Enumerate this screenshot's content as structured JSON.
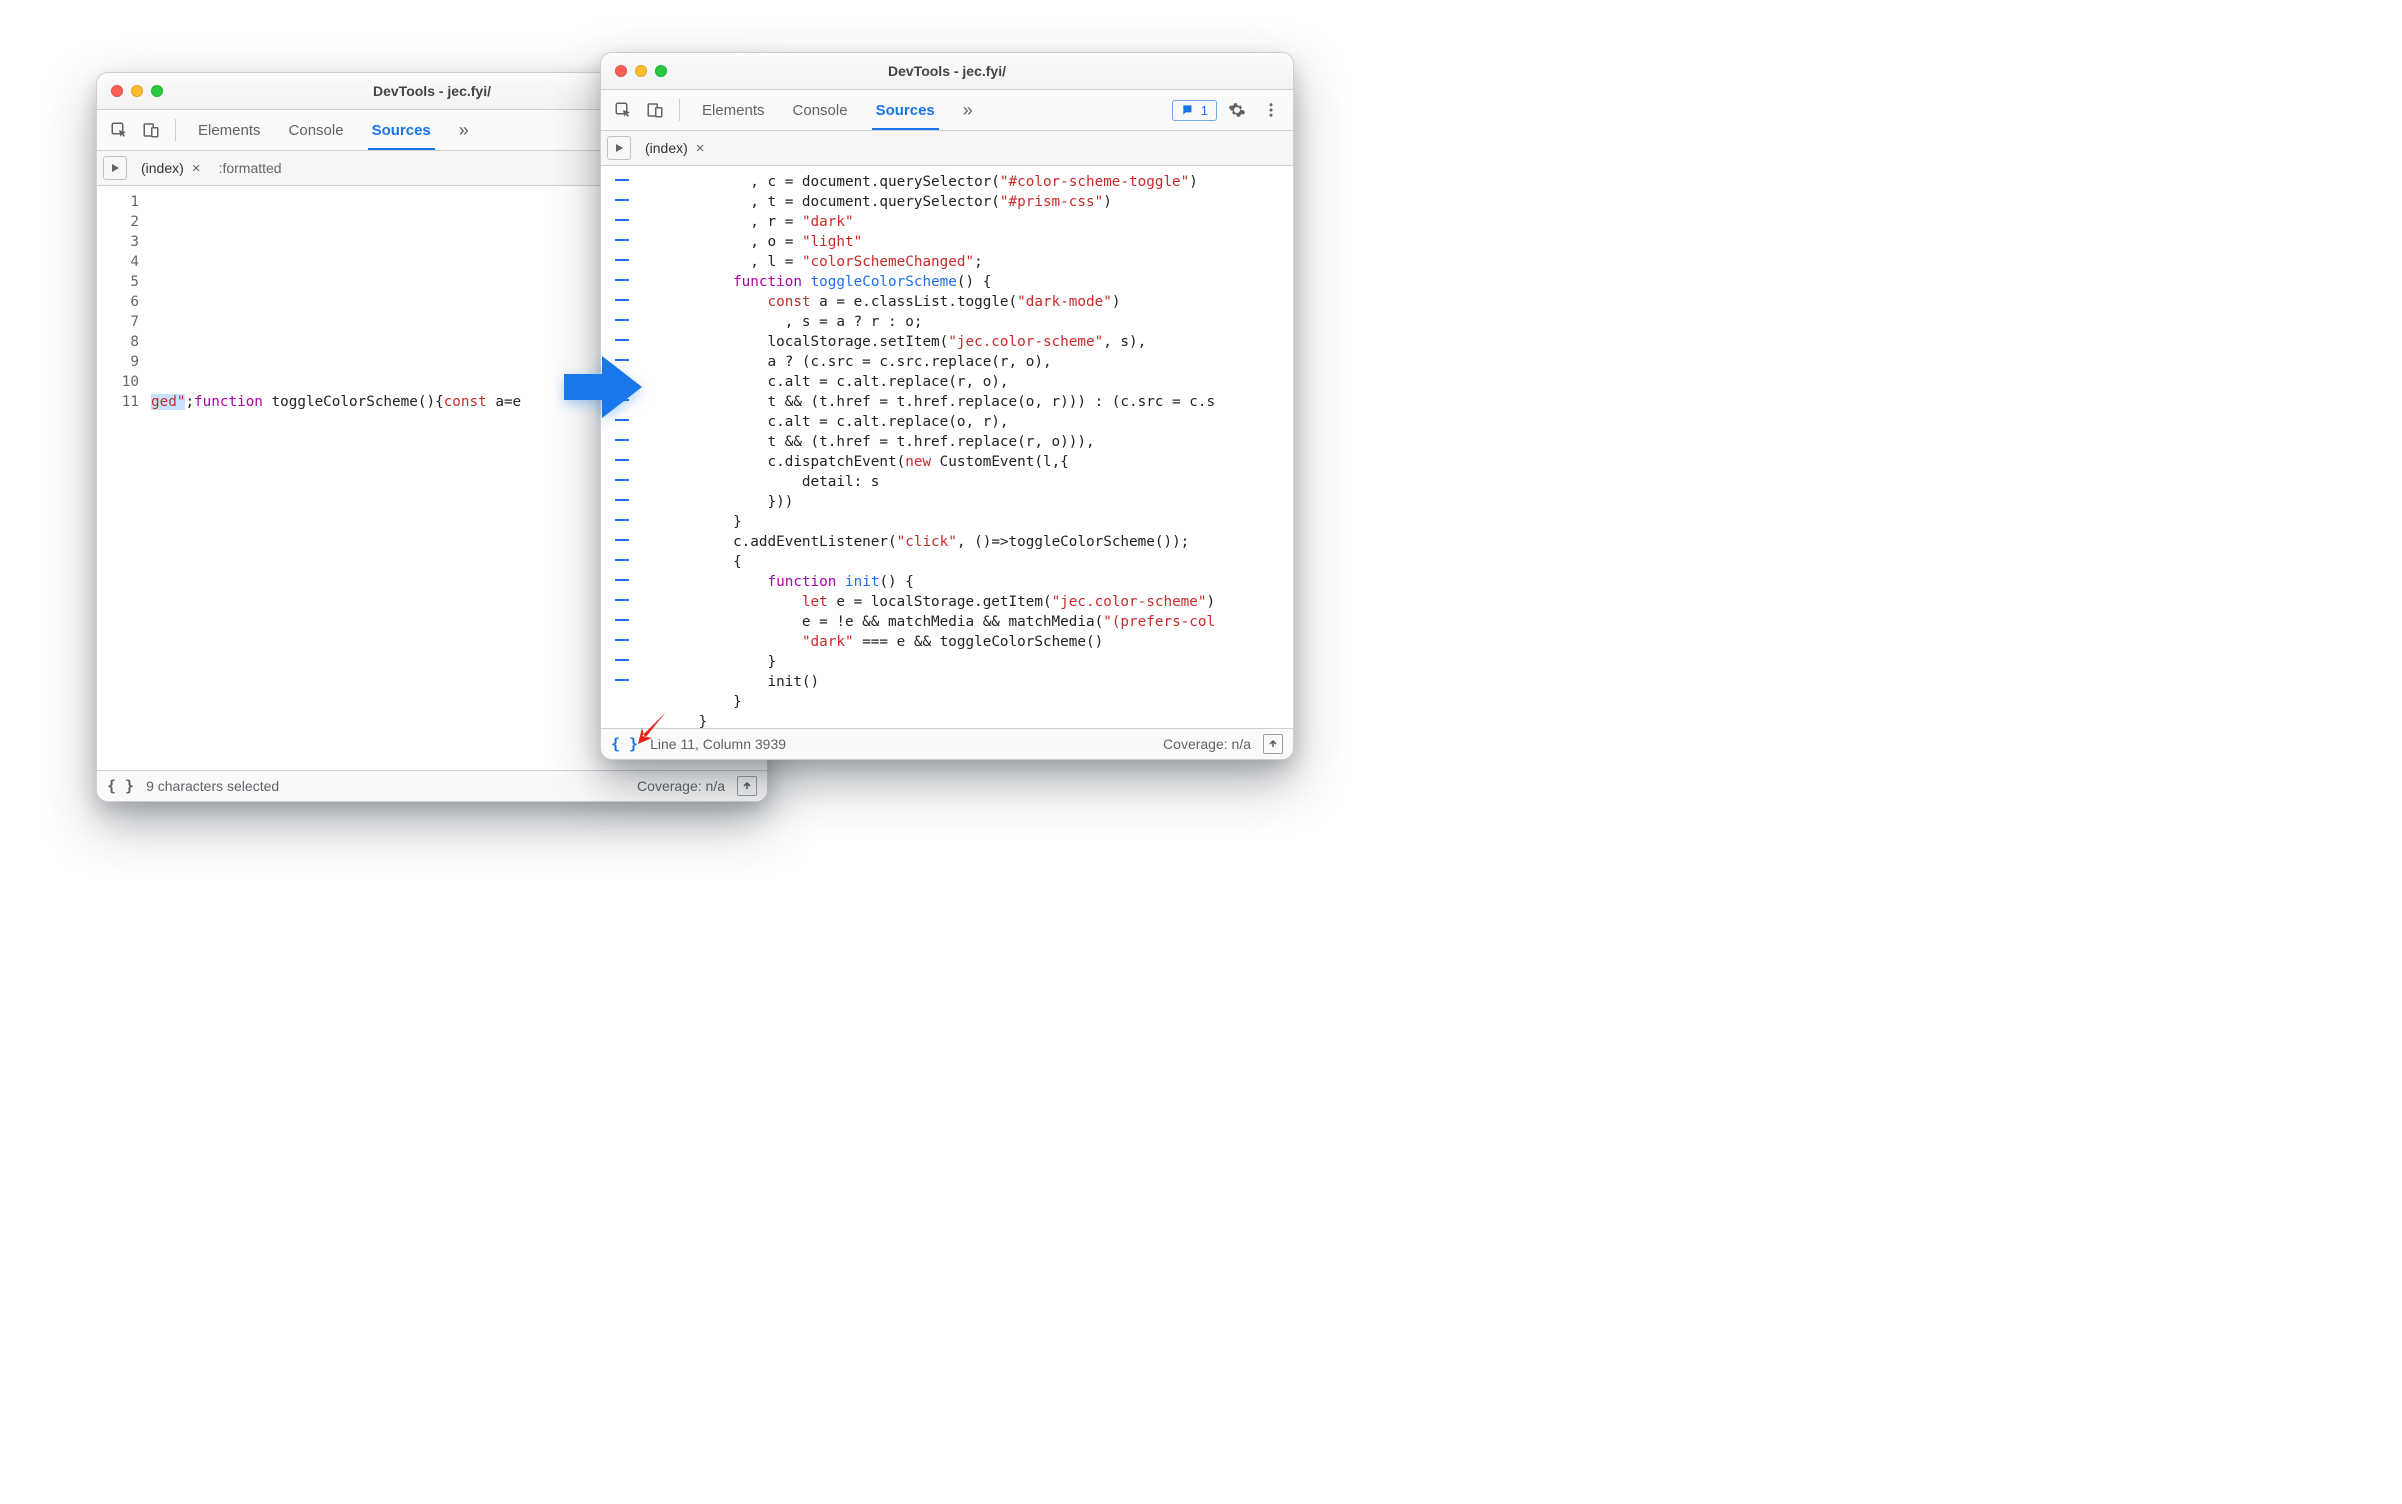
{
  "left_window": {
    "title": "DevTools - jec.fyi/",
    "tabs": {
      "elements": "Elements",
      "console": "Console",
      "sources": "Sources",
      "more": "»"
    },
    "file_tabs": {
      "index": "(index)",
      "formatted": ":formatted"
    },
    "gutter_lines": [
      "1",
      "2",
      "3",
      "4",
      "5",
      "6",
      "7",
      "8",
      "9",
      "10",
      "11"
    ],
    "code_line11": {
      "frag1": "ged\"",
      "frag2": ";",
      "frag3": "function",
      "frag4": " toggleColorScheme(){",
      "frag5": "const",
      "frag6": " a=e"
    },
    "status": {
      "braces": "{ }",
      "selection": "9 characters selected",
      "coverage": "Coverage: n/a"
    }
  },
  "right_window": {
    "title": "DevTools - jec.fyi/",
    "tabs": {
      "elements": "Elements",
      "console": "Console",
      "sources": "Sources",
      "more": "»"
    },
    "issues_count": "1",
    "file_tabs": {
      "index": "(index)"
    },
    "dash_count": 26,
    "code_lines": [
      [
        [
          "p",
          "            , c = document.querySelector("
        ],
        [
          "s",
          "\"#color-scheme-toggle\""
        ],
        [
          "p",
          ")"
        ]
      ],
      [
        [
          "p",
          "            , t = document.querySelector("
        ],
        [
          "s",
          "\"#prism-css\""
        ],
        [
          "p",
          ")"
        ]
      ],
      [
        [
          "p",
          "            , r = "
        ],
        [
          "s",
          "\"dark\""
        ]
      ],
      [
        [
          "p",
          "            , o = "
        ],
        [
          "s",
          "\"light\""
        ]
      ],
      [
        [
          "p",
          "            , l = "
        ],
        [
          "s",
          "\"colorSchemeChanged\""
        ],
        [
          "p",
          ";"
        ]
      ],
      [
        [
          "p",
          "          "
        ],
        [
          "k",
          "function"
        ],
        [
          "p",
          " "
        ],
        [
          "fn",
          "toggleColorScheme"
        ],
        [
          "p",
          "() {"
        ]
      ],
      [
        [
          "p",
          "              "
        ],
        [
          "kr",
          "const"
        ],
        [
          "p",
          " a = e.classList.toggle("
        ],
        [
          "s",
          "\"dark-mode\""
        ],
        [
          "p",
          ")"
        ]
      ],
      [
        [
          "p",
          "                , s = a ? r : o;"
        ]
      ],
      [
        [
          "p",
          "              localStorage.setItem("
        ],
        [
          "s",
          "\"jec.color-scheme\""
        ],
        [
          "p",
          ", s),"
        ]
      ],
      [
        [
          "p",
          "              a ? (c.src = c.src.replace(r, o),"
        ]
      ],
      [
        [
          "p",
          "              c.alt = c.alt.replace(r, o),"
        ]
      ],
      [
        [
          "p",
          "              t && (t.href = t.href.replace(o, r))) : (c.src = c.s"
        ]
      ],
      [
        [
          "p",
          "              c.alt = c.alt.replace(o, r),"
        ]
      ],
      [
        [
          "p",
          "              t && (t.href = t.href.replace(r, o))),"
        ]
      ],
      [
        [
          "p",
          "              c.dispatchEvent("
        ],
        [
          "kr",
          "new"
        ],
        [
          "p",
          " CustomEvent(l,{"
        ]
      ],
      [
        [
          "p",
          "                  detail: s"
        ]
      ],
      [
        [
          "p",
          "              }))"
        ]
      ],
      [
        [
          "p",
          "          }"
        ]
      ],
      [
        [
          "p",
          "          c.addEventListener("
        ],
        [
          "s",
          "\"click\""
        ],
        [
          "p",
          ", ()=>toggleColorScheme());"
        ]
      ],
      [
        [
          "p",
          "          {"
        ]
      ],
      [
        [
          "p",
          "              "
        ],
        [
          "k",
          "function"
        ],
        [
          "p",
          " "
        ],
        [
          "fn",
          "init"
        ],
        [
          "p",
          "() {"
        ]
      ],
      [
        [
          "p",
          "                  "
        ],
        [
          "kr",
          "let"
        ],
        [
          "p",
          " e = localStorage.getItem("
        ],
        [
          "s",
          "\"jec.color-scheme\""
        ],
        [
          "p",
          ")"
        ]
      ],
      [
        [
          "p",
          "                  e = !e && matchMedia && matchMedia("
        ],
        [
          "s",
          "\"(prefers-col"
        ]
      ],
      [
        [
          "p",
          "                  "
        ],
        [
          "s",
          "\"dark\""
        ],
        [
          "p",
          " === e && toggleColorScheme()"
        ]
      ],
      [
        [
          "p",
          "              }"
        ]
      ],
      [
        [
          "p",
          "              init()"
        ]
      ],
      [
        [
          "p",
          "          }"
        ]
      ],
      [
        [
          "p",
          "      }"
        ]
      ]
    ],
    "status": {
      "braces": "{ }",
      "cursor": "Line 11, Column 3939",
      "coverage": "Coverage: n/a"
    }
  }
}
